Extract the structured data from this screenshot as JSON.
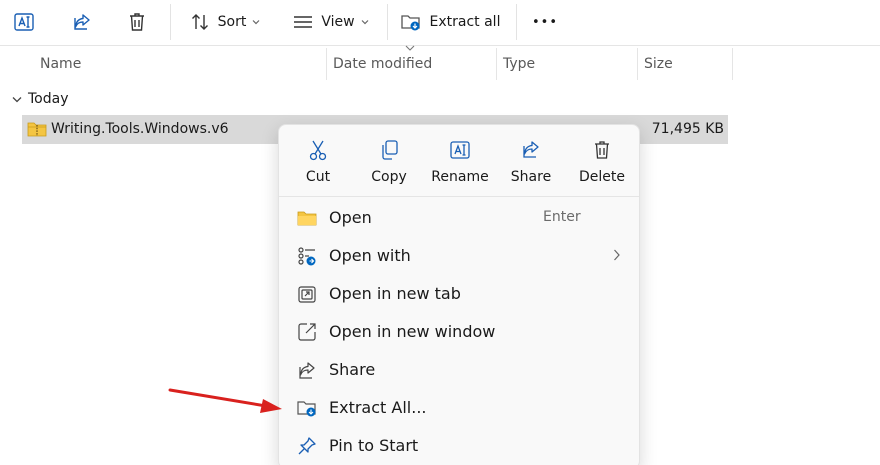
{
  "toolbar": {
    "sort_label": "Sort",
    "view_label": "View",
    "extract_all_label": "Extract all",
    "more_label": "•••"
  },
  "columns": {
    "name": "Name",
    "date_modified": "Date modified",
    "type": "Type",
    "size": "Size"
  },
  "group": {
    "label": "Today"
  },
  "file": {
    "name": "Writing.Tools.Windows.v6",
    "size": "71,495 KB"
  },
  "context_menu": {
    "quick_actions": [
      {
        "label": "Cut",
        "icon": "scissors-icon"
      },
      {
        "label": "Copy",
        "icon": "copy-icon"
      },
      {
        "label": "Rename",
        "icon": "rename-icon"
      },
      {
        "label": "Share",
        "icon": "share-icon"
      },
      {
        "label": "Delete",
        "icon": "trash-icon"
      }
    ],
    "items": [
      {
        "label": "Open",
        "accelerator": "Enter",
        "icon": "folder-icon"
      },
      {
        "label": "Open with",
        "icon": "open-with-icon",
        "submenu": true
      },
      {
        "label": "Open in new tab",
        "icon": "new-tab-icon"
      },
      {
        "label": "Open in new window",
        "icon": "new-window-icon"
      },
      {
        "label": "Share",
        "icon": "share-icon"
      },
      {
        "label": "Extract All...",
        "icon": "extract-icon"
      },
      {
        "label": "Pin to Start",
        "icon": "pin-icon"
      }
    ]
  },
  "colors": {
    "accent": "#0067c0",
    "selection": "#d9d9d9",
    "annotation_arrow": "#d9211e",
    "folder_yellow": "#f4c542"
  }
}
